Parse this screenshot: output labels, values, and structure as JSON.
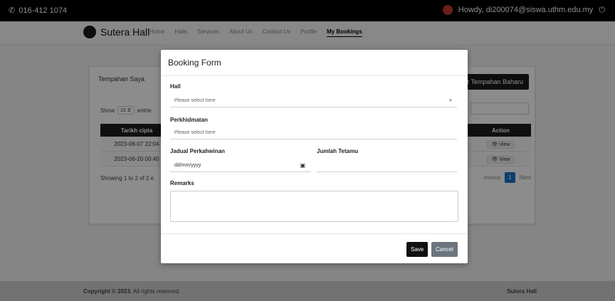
{
  "topbar": {
    "phone": "016-412 1074",
    "greeting": "Howdy, di200074@siswa.uthm.edu.my"
  },
  "navbar": {
    "brand": "Sutera Hall",
    "links": [
      "Home",
      "Halls",
      "Services",
      "About Us",
      "Contact Us",
      "Profile",
      "My Bookings"
    ]
  },
  "page": {
    "card_title": "Tempahan Saya",
    "add_button": "uat Tempahan Baharu",
    "show_label": "Show",
    "entries_value": "10",
    "entries_label": "entrie",
    "columns": [
      "Tarikh cipta",
      "Action"
    ],
    "rows": [
      {
        "date": "2023-06-07 22:04",
        "action": "View"
      },
      {
        "date": "2023-06-20 00:40",
        "action": "View"
      }
    ],
    "showing_text": "Showing 1 to 2 of 2 e",
    "pager": {
      "prev": "evious",
      "current": "1",
      "next": "Next"
    }
  },
  "footer": {
    "copyright_bold": "Copyright © 2023.",
    "copyright_rest": " All rights reserved.",
    "brand": "Sutera Hall"
  },
  "modal": {
    "title": "Booking Form",
    "hall_label": "Hall",
    "hall_placeholder": "Please select here",
    "service_label": "Perkhidmatan",
    "service_placeholder": "Please select here",
    "date_label": "Jadual Perkahwinan",
    "date_placeholder": "dd/mm/yyyy",
    "guests_label": "Jumlah Tetamu",
    "remarks_label": "Remarks",
    "save": "Save",
    "cancel": "Cancel"
  }
}
